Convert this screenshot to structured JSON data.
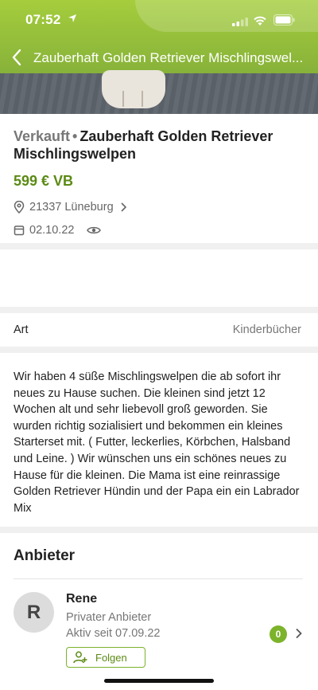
{
  "status_bar": {
    "time": "07:52"
  },
  "nav": {
    "title": "Zauberhaft Golden Retriever Mischlingswel..."
  },
  "listing": {
    "status": "Verkauft",
    "separator": "•",
    "title": "Zauberhaft Golden Retriever Mischlingswelpen",
    "price": "599 € VB",
    "location": "21337 Lüneburg",
    "date": "02.10.22"
  },
  "details": {
    "art_label": "Art",
    "art_value": "Kinderbücher"
  },
  "description": "Wir haben 4 süße Mischlingswelpen die ab sofort ihr neues zu Hause suchen. Die kleinen sind jetzt 12 Wochen alt und sehr liebevoll groß geworden. Sie wurden richtig sozialisiert und bekommen ein kleines Starterset mit. ( Futter, leckerlies, Körbchen, Halsband und Leine. ) Wir wünschen uns ein schönes neues zu Hause für die kleinen. Die Mama ist eine reinrassige Golden Retriever Hündin und der Papa ein ein Labrador Mix",
  "seller": {
    "section_title": "Anbieter",
    "avatar_initial": "R",
    "name": "Rene",
    "type": "Privater Anbieter",
    "active_since": "Aktiv seit 07.09.22",
    "badge_count": "0",
    "follow_label": "Folgen"
  },
  "colors": {
    "accent": "#5b8a14",
    "badge": "#7cb32b"
  }
}
